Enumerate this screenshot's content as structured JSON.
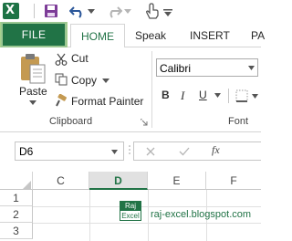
{
  "qat": {
    "app_icon": "excel-icon",
    "app_letter": "X",
    "icons": [
      "save-icon",
      "undo-icon",
      "redo-icon",
      "touch-mode-icon",
      "customize-qat-icon"
    ]
  },
  "tabs": {
    "file": "FILE",
    "home": "HOME",
    "speak": "Speak",
    "insert": "INSERT",
    "partial": "PA"
  },
  "clipboard": {
    "paste": "Paste",
    "cut": "Cut",
    "copy": "Copy",
    "format_painter": "Format Painter",
    "group_label": "Clipboard"
  },
  "font": {
    "name": "Calibri",
    "bold": "B",
    "italic": "I",
    "underline": "U",
    "group_label": "Font"
  },
  "formula_bar": {
    "name_box": "D6",
    "fx": "fx"
  },
  "grid": {
    "columns": [
      "C",
      "D",
      "E",
      "F"
    ],
    "rows": [
      "1",
      "2",
      "3"
    ],
    "selected_column": "D"
  },
  "watermark": {
    "top": "Raj",
    "bottom": "Excel",
    "site": "raj-excel.blogspot.com"
  },
  "colors": {
    "accent": "#217346"
  }
}
